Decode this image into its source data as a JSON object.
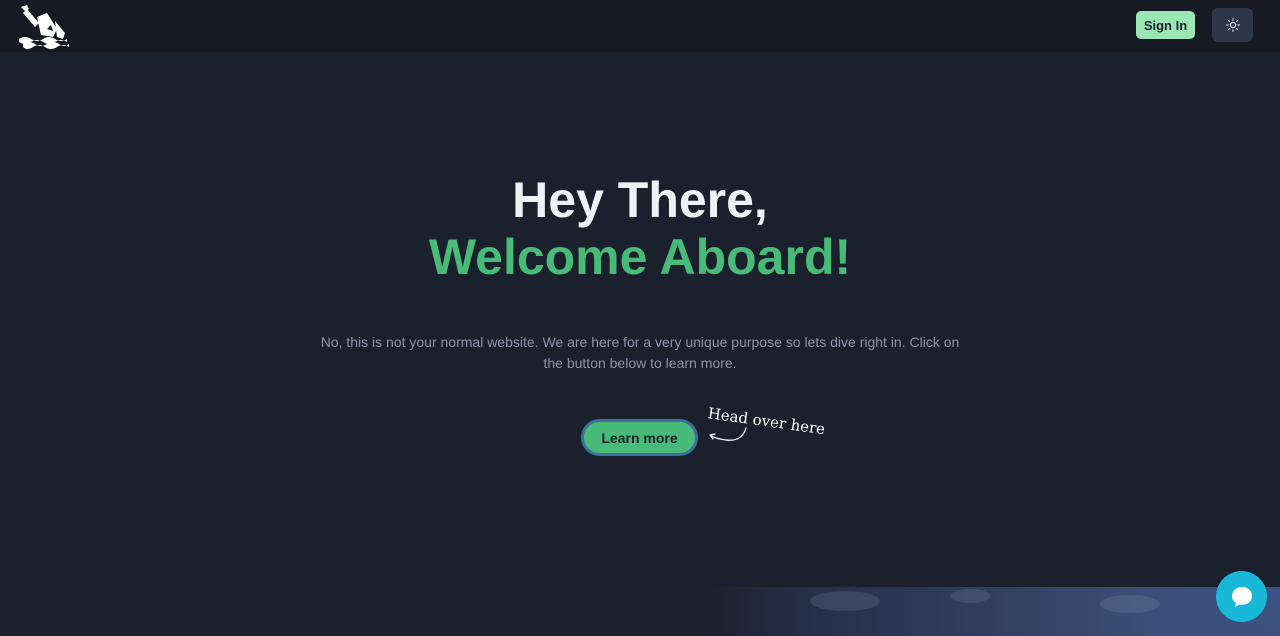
{
  "header": {
    "logo_icon": "ship-logo-icon",
    "signin_label": "Sign In",
    "theme_icon": "sun-icon",
    "signin_color": "#9ae6b4"
  },
  "hero": {
    "title_line1": "Hey There,",
    "title_line2": "Welcome Aboard!",
    "description": "No, this is not your normal website. We are here for a very unique purpose so lets dive right in. Click on the button below to learn more.",
    "cta_label": "Learn more",
    "annotation": "Head over here",
    "accent_color": "#48bb78"
  },
  "chat": {
    "icon": "chat-bubble-icon",
    "color": "#1ab8d8"
  }
}
